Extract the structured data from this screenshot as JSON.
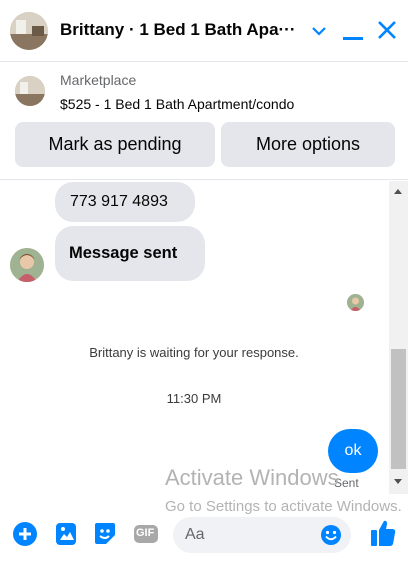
{
  "header": {
    "title": "Brittany · 1 Bed 1 Bath Apa···",
    "colors": {
      "accent": "#0084ff"
    },
    "icons": [
      "chevron-down-icon",
      "minimize-icon",
      "close-icon"
    ]
  },
  "listing": {
    "label": "Marketplace",
    "title": "$525 - 1 Bed 1 Bath Apartment/condo",
    "buttons": {
      "pending": "Mark as pending",
      "more": "More options"
    }
  },
  "messages": {
    "phone": "773 917 4893",
    "sent_text": "Message sent",
    "waiting": "Brittany is waiting for your response.",
    "time": "11:30 PM",
    "outgoing": "ok",
    "status": "Sent"
  },
  "watermark": {
    "line1": "Activate Windows",
    "line2": "Go to Settings to activate Windows."
  },
  "composer": {
    "placeholder": "Aa",
    "icons": [
      "plus-icon",
      "image-icon",
      "sticker-icon",
      "gif-icon",
      "emoji-icon",
      "thumbs-up-icon"
    ],
    "gif_label": "GIF"
  }
}
